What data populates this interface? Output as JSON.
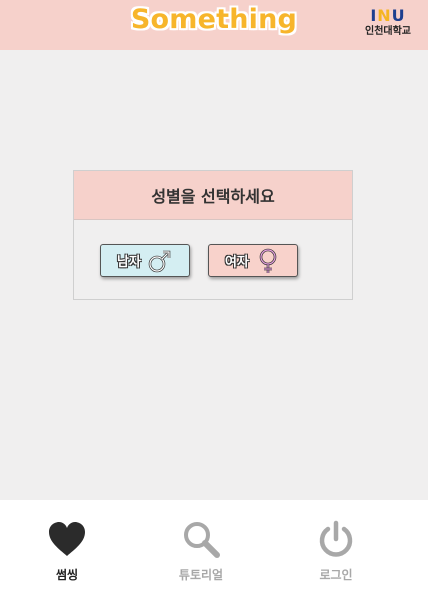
{
  "header": {
    "logo_text": "Something",
    "university_mark_1": "I",
    "university_mark_2": "N",
    "university_mark_3": "U",
    "university_name": "인천대학교"
  },
  "dialog": {
    "title": "성별을 선택하세요",
    "male_label": "남자",
    "female_label": "여자"
  },
  "bottom_nav": {
    "tabs": [
      {
        "label": "썸씽",
        "icon": "heart-icon",
        "active": true
      },
      {
        "label": "튜토리얼",
        "icon": "search-icon",
        "active": false
      },
      {
        "label": "로그인",
        "icon": "power-icon",
        "active": false
      }
    ]
  },
  "colors": {
    "header_bg": "#f6d1cb",
    "logo": "#f7b52b",
    "male_btn": "#d4eef2",
    "female_btn": "#f8d2cb",
    "content_bg": "#f0efef",
    "inactive": "#a8a8a8"
  }
}
